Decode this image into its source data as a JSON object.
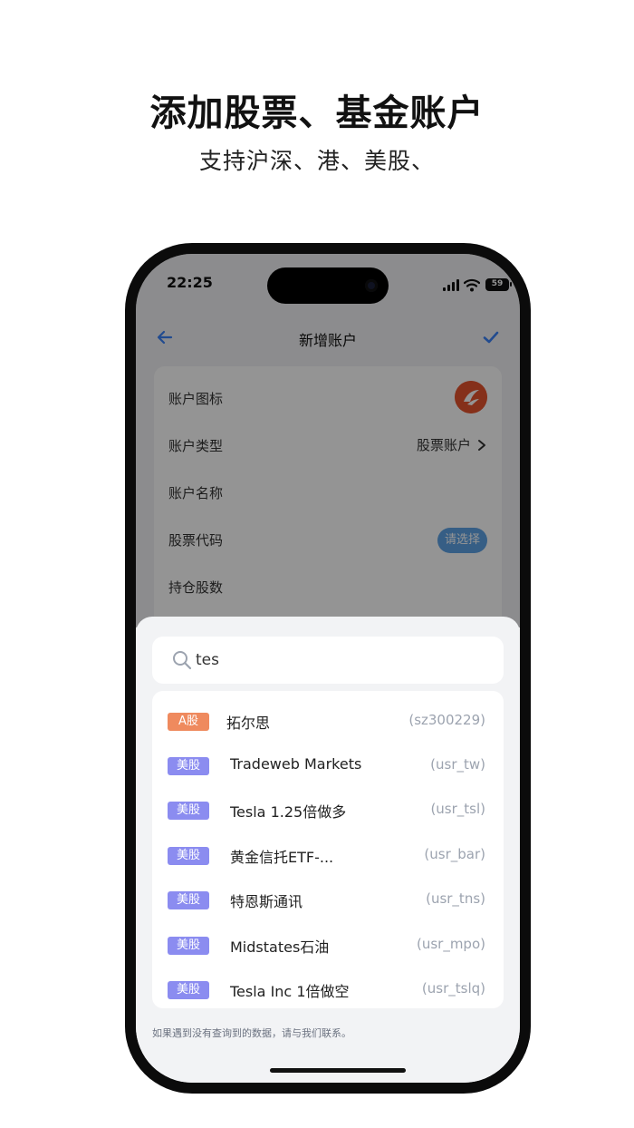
{
  "promo": {
    "title": "添加股票、基金账户",
    "subtitle": "支持沪深、港、美股、"
  },
  "status_bar": {
    "time": "22:25",
    "battery": "59"
  },
  "nav": {
    "title": "新增账户",
    "back_icon": "arrow-left-icon",
    "confirm_icon": "check-icon"
  },
  "form": {
    "rows": [
      {
        "label": "账户图标",
        "value": ""
      },
      {
        "label": "账户类型",
        "value": "股票账户"
      },
      {
        "label": "账户名称",
        "value": ""
      },
      {
        "label": "股票代码",
        "value": "请选择"
      },
      {
        "label": "持仓股数",
        "value": ""
      }
    ]
  },
  "search": {
    "value": "tes"
  },
  "results": [
    {
      "market": "A股",
      "name": "拓尔思",
      "code": "(sz300229)"
    },
    {
      "market": "美股",
      "name": "Tradeweb Markets",
      "code": "(usr_tw)"
    },
    {
      "market": "美股",
      "name": "Tesla 1.25倍做多",
      "code": "(usr_tsl)"
    },
    {
      "market": "美股",
      "name": "黄金信托ETF-...",
      "code": "(usr_bar)"
    },
    {
      "market": "美股",
      "name": "特恩斯通讯",
      "code": "(usr_tns)"
    },
    {
      "market": "美股",
      "name": "Midstates石油",
      "code": "(usr_mpo)"
    },
    {
      "market": "美股",
      "name": "Tesla Inc 1倍做空",
      "code": "(usr_tslq)"
    }
  ],
  "footer": {
    "note": "如果遇到没有查询到的数据，请与我们联系。"
  },
  "colors": {
    "accent_blue": "#3b82f6",
    "badge_a": "#ef8a5e",
    "badge_us": "#8b8cf0",
    "account_icon": "#e5532d"
  }
}
